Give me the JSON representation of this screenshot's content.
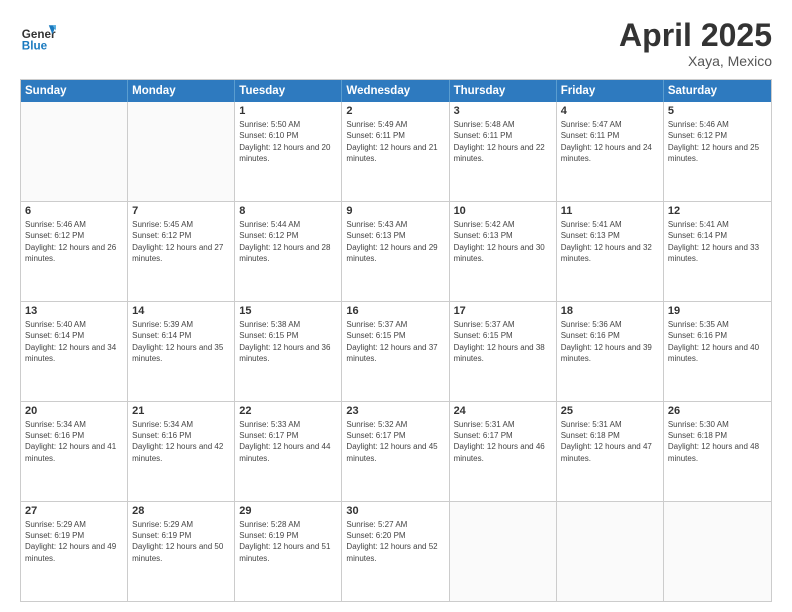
{
  "header": {
    "logo_general": "General",
    "logo_blue": "Blue",
    "month_title": "April 2025",
    "location": "Xaya, Mexico"
  },
  "days_of_week": [
    "Sunday",
    "Monday",
    "Tuesday",
    "Wednesday",
    "Thursday",
    "Friday",
    "Saturday"
  ],
  "weeks": [
    [
      {
        "day": "",
        "empty": true
      },
      {
        "day": "",
        "empty": true
      },
      {
        "day": "1",
        "sunrise": "Sunrise: 5:50 AM",
        "sunset": "Sunset: 6:10 PM",
        "daylight": "Daylight: 12 hours and 20 minutes."
      },
      {
        "day": "2",
        "sunrise": "Sunrise: 5:49 AM",
        "sunset": "Sunset: 6:11 PM",
        "daylight": "Daylight: 12 hours and 21 minutes."
      },
      {
        "day": "3",
        "sunrise": "Sunrise: 5:48 AM",
        "sunset": "Sunset: 6:11 PM",
        "daylight": "Daylight: 12 hours and 22 minutes."
      },
      {
        "day": "4",
        "sunrise": "Sunrise: 5:47 AM",
        "sunset": "Sunset: 6:11 PM",
        "daylight": "Daylight: 12 hours and 24 minutes."
      },
      {
        "day": "5",
        "sunrise": "Sunrise: 5:46 AM",
        "sunset": "Sunset: 6:12 PM",
        "daylight": "Daylight: 12 hours and 25 minutes."
      }
    ],
    [
      {
        "day": "6",
        "sunrise": "Sunrise: 5:46 AM",
        "sunset": "Sunset: 6:12 PM",
        "daylight": "Daylight: 12 hours and 26 minutes."
      },
      {
        "day": "7",
        "sunrise": "Sunrise: 5:45 AM",
        "sunset": "Sunset: 6:12 PM",
        "daylight": "Daylight: 12 hours and 27 minutes."
      },
      {
        "day": "8",
        "sunrise": "Sunrise: 5:44 AM",
        "sunset": "Sunset: 6:12 PM",
        "daylight": "Daylight: 12 hours and 28 minutes."
      },
      {
        "day": "9",
        "sunrise": "Sunrise: 5:43 AM",
        "sunset": "Sunset: 6:13 PM",
        "daylight": "Daylight: 12 hours and 29 minutes."
      },
      {
        "day": "10",
        "sunrise": "Sunrise: 5:42 AM",
        "sunset": "Sunset: 6:13 PM",
        "daylight": "Daylight: 12 hours and 30 minutes."
      },
      {
        "day": "11",
        "sunrise": "Sunrise: 5:41 AM",
        "sunset": "Sunset: 6:13 PM",
        "daylight": "Daylight: 12 hours and 32 minutes."
      },
      {
        "day": "12",
        "sunrise": "Sunrise: 5:41 AM",
        "sunset": "Sunset: 6:14 PM",
        "daylight": "Daylight: 12 hours and 33 minutes."
      }
    ],
    [
      {
        "day": "13",
        "sunrise": "Sunrise: 5:40 AM",
        "sunset": "Sunset: 6:14 PM",
        "daylight": "Daylight: 12 hours and 34 minutes."
      },
      {
        "day": "14",
        "sunrise": "Sunrise: 5:39 AM",
        "sunset": "Sunset: 6:14 PM",
        "daylight": "Daylight: 12 hours and 35 minutes."
      },
      {
        "day": "15",
        "sunrise": "Sunrise: 5:38 AM",
        "sunset": "Sunset: 6:15 PM",
        "daylight": "Daylight: 12 hours and 36 minutes."
      },
      {
        "day": "16",
        "sunrise": "Sunrise: 5:37 AM",
        "sunset": "Sunset: 6:15 PM",
        "daylight": "Daylight: 12 hours and 37 minutes."
      },
      {
        "day": "17",
        "sunrise": "Sunrise: 5:37 AM",
        "sunset": "Sunset: 6:15 PM",
        "daylight": "Daylight: 12 hours and 38 minutes."
      },
      {
        "day": "18",
        "sunrise": "Sunrise: 5:36 AM",
        "sunset": "Sunset: 6:16 PM",
        "daylight": "Daylight: 12 hours and 39 minutes."
      },
      {
        "day": "19",
        "sunrise": "Sunrise: 5:35 AM",
        "sunset": "Sunset: 6:16 PM",
        "daylight": "Daylight: 12 hours and 40 minutes."
      }
    ],
    [
      {
        "day": "20",
        "sunrise": "Sunrise: 5:34 AM",
        "sunset": "Sunset: 6:16 PM",
        "daylight": "Daylight: 12 hours and 41 minutes."
      },
      {
        "day": "21",
        "sunrise": "Sunrise: 5:34 AM",
        "sunset": "Sunset: 6:16 PM",
        "daylight": "Daylight: 12 hours and 42 minutes."
      },
      {
        "day": "22",
        "sunrise": "Sunrise: 5:33 AM",
        "sunset": "Sunset: 6:17 PM",
        "daylight": "Daylight: 12 hours and 44 minutes."
      },
      {
        "day": "23",
        "sunrise": "Sunrise: 5:32 AM",
        "sunset": "Sunset: 6:17 PM",
        "daylight": "Daylight: 12 hours and 45 minutes."
      },
      {
        "day": "24",
        "sunrise": "Sunrise: 5:31 AM",
        "sunset": "Sunset: 6:17 PM",
        "daylight": "Daylight: 12 hours and 46 minutes."
      },
      {
        "day": "25",
        "sunrise": "Sunrise: 5:31 AM",
        "sunset": "Sunset: 6:18 PM",
        "daylight": "Daylight: 12 hours and 47 minutes."
      },
      {
        "day": "26",
        "sunrise": "Sunrise: 5:30 AM",
        "sunset": "Sunset: 6:18 PM",
        "daylight": "Daylight: 12 hours and 48 minutes."
      }
    ],
    [
      {
        "day": "27",
        "sunrise": "Sunrise: 5:29 AM",
        "sunset": "Sunset: 6:19 PM",
        "daylight": "Daylight: 12 hours and 49 minutes."
      },
      {
        "day": "28",
        "sunrise": "Sunrise: 5:29 AM",
        "sunset": "Sunset: 6:19 PM",
        "daylight": "Daylight: 12 hours and 50 minutes."
      },
      {
        "day": "29",
        "sunrise": "Sunrise: 5:28 AM",
        "sunset": "Sunset: 6:19 PM",
        "daylight": "Daylight: 12 hours and 51 minutes."
      },
      {
        "day": "30",
        "sunrise": "Sunrise: 5:27 AM",
        "sunset": "Sunset: 6:20 PM",
        "daylight": "Daylight: 12 hours and 52 minutes."
      },
      {
        "day": "",
        "empty": true
      },
      {
        "day": "",
        "empty": true
      },
      {
        "day": "",
        "empty": true
      }
    ]
  ]
}
